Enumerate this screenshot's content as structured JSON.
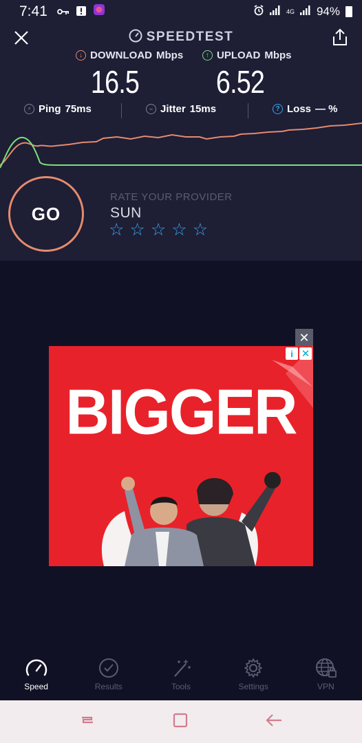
{
  "status_bar": {
    "time": "7:41",
    "network": "4G",
    "battery": "94%",
    "icons": [
      "key-icon",
      "alert-icon",
      "app-icon",
      "alarm-icon",
      "signal-icon",
      "battery-icon"
    ]
  },
  "header": {
    "title": "SPEEDTEST"
  },
  "download": {
    "label": "DOWNLOAD",
    "unit": "Mbps",
    "value": "16.5",
    "color": "#e58b6c"
  },
  "upload": {
    "label": "UPLOAD",
    "unit": "Mbps",
    "value": "6.52",
    "color": "#7be07a"
  },
  "stats": {
    "ping_label": "Ping",
    "ping_value": "75ms",
    "jitter_label": "Jitter",
    "jitter_value": "15ms",
    "loss_label": "Loss",
    "loss_value": "— %"
  },
  "go_button": {
    "label": "GO"
  },
  "rating": {
    "label": "RATE YOUR PROVIDER",
    "provider": "SUN",
    "stars": 5,
    "filled": 0
  },
  "ad": {
    "headline": "BIGGER",
    "info_label": "i",
    "close_label": "✕"
  },
  "bottom_nav": {
    "items": [
      {
        "label": "Speed",
        "icon": "speed-gauge-icon",
        "active": true
      },
      {
        "label": "Results",
        "icon": "check-circle-icon",
        "active": false
      },
      {
        "label": "Tools",
        "icon": "magic-wand-icon",
        "active": false
      },
      {
        "label": "Settings",
        "icon": "gear-icon",
        "active": false
      },
      {
        "label": "VPN",
        "icon": "globe-lock-icon",
        "active": false
      }
    ]
  },
  "colors": {
    "background": "#111126",
    "panel": "#1e1e35",
    "accent_download": "#e58b6c",
    "accent_upload": "#7be07a",
    "star": "#39a4e8",
    "ad_red": "#e8222a"
  }
}
